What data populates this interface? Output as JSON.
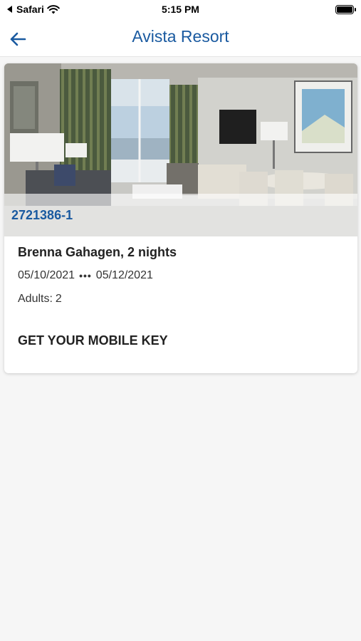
{
  "status_bar": {
    "back_app": "Safari",
    "time": "5:15 PM"
  },
  "nav": {
    "title": "Avista Resort"
  },
  "reservation": {
    "confirmation_number": "2721386-1",
    "guest_line": "Brenna Gahagen, 2 nights",
    "check_in": "05/10/2021",
    "separator": "•••",
    "check_out": "05/12/2021",
    "adults_label": "Adults:",
    "adults_value": "2",
    "mobile_key_label": "GET YOUR MOBILE KEY"
  },
  "colors": {
    "brand_blue": "#1a5aa0",
    "background": "#f6f6f6"
  },
  "icons": {
    "back": "arrow-left-icon",
    "wifi": "wifi-icon",
    "battery": "battery-icon"
  }
}
